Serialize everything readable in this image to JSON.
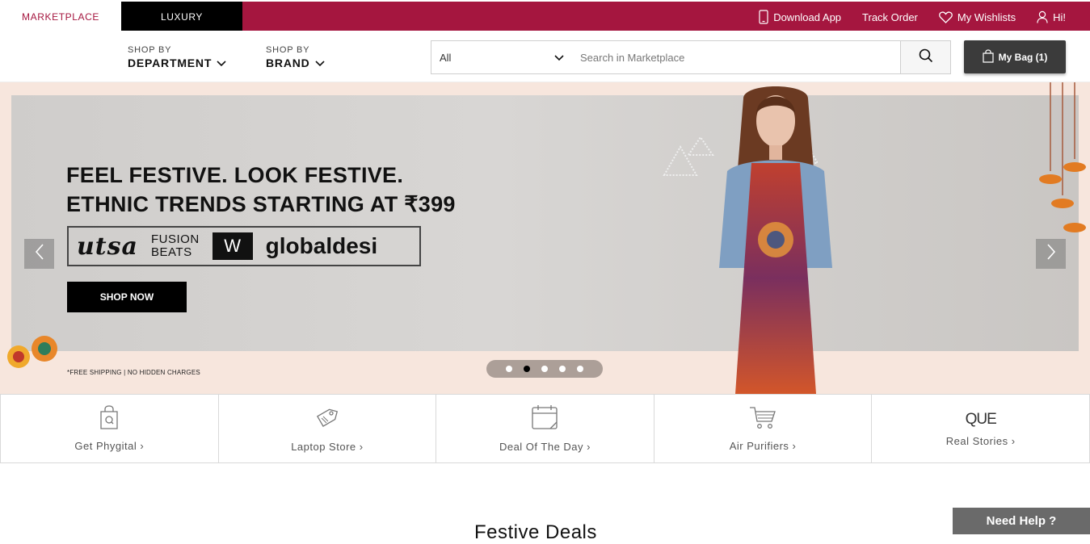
{
  "topbar": {
    "tabs": [
      {
        "label": "MARKETPLACE"
      },
      {
        "label": "LUXURY"
      }
    ],
    "links": [
      {
        "label": "Download App",
        "icon": "phone-icon"
      },
      {
        "label": "Track Order"
      },
      {
        "label": "My Wishlists",
        "icon": "heart-icon"
      },
      {
        "label": "Hi!",
        "icon": "user-icon"
      }
    ]
  },
  "header": {
    "shop_by_department": {
      "small": "SHOP BY",
      "big": "DEPARTMENT"
    },
    "shop_by_brand": {
      "small": "SHOP BY",
      "big": "BRAND"
    },
    "search": {
      "category": "All",
      "placeholder": "Search in Marketplace"
    },
    "bag": {
      "label": "My Bag (1)"
    }
  },
  "hero": {
    "headline_1": "FEEL FESTIVE. LOOK FESTIVE.",
    "headline_2": "ETHNIC TRENDS STARTING AT ₹399",
    "brands": {
      "utsa": "utsa",
      "fusion_1": "FUSION",
      "fusion_2": "BEATS",
      "w": "W",
      "globaldesi": "globaldesi"
    },
    "cta": "SHOP NOW",
    "note": "*FREE SHIPPING | NO HIDDEN CHARGES",
    "active_slide": 2,
    "slide_count": 5
  },
  "categories": [
    {
      "label": "Get Phygital",
      "icon": "shopping-bag-icon"
    },
    {
      "label": "Laptop Store",
      "icon": "tag-icon"
    },
    {
      "label": "Deal Of The Day",
      "icon": "calendar-icon"
    },
    {
      "label": "Air Purifiers",
      "icon": "cart-icon"
    },
    {
      "label": "Real Stories",
      "icon": "que-logo",
      "logo_text": "QUE"
    }
  ],
  "section_title": "Festive Deals",
  "help": {
    "label": "Need Help ?"
  },
  "colors": {
    "brand": "#a5163f",
    "dark": "#3b3b3b"
  }
}
